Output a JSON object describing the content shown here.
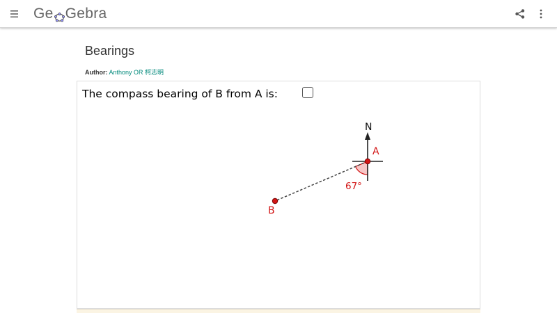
{
  "header": {
    "logo_prefix": "Ge",
    "logo_suffix": "Gebra",
    "menu_icon": "hamburger-menu-icon",
    "share_icon": "share-icon",
    "more_icon": "more-vertical-icon"
  },
  "page": {
    "title": "Bearings",
    "author_label": "Author:",
    "author_name": "Anthony OR 柯志明"
  },
  "applet": {
    "question": "The compass bearing of B from A is:",
    "checkbox_checked": false,
    "north_label": "N",
    "point_a_label": "A",
    "point_b_label": "B",
    "angle_label": "67°",
    "colors": {
      "point": "#d21414",
      "label": "#d21414",
      "angle_fill": "#f7c6c6",
      "axes": "#222222",
      "accent_link": "#00897b"
    }
  }
}
